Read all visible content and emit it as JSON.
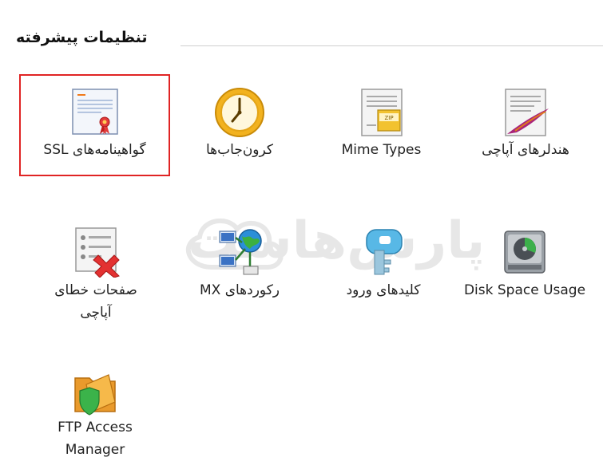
{
  "section": {
    "title": "تنظیمات پیشرفته"
  },
  "watermark": {
    "text": "پارس‌هاست"
  },
  "items": [
    {
      "label": "گواهینامه‌های SSL",
      "icon": "certificate-icon",
      "selected": true
    },
    {
      "label": "کرون‌جاب‌ها",
      "icon": "clock-icon"
    },
    {
      "label": "Mime Types",
      "icon": "zip-file-icon"
    },
    {
      "label": "هندلرهای آپاچی",
      "icon": "apache-feather-icon"
    },
    {
      "label_line1": "صفحات خطای",
      "label_line2": "آپاچی",
      "icon": "error-page-icon"
    },
    {
      "label": "رکوردهای MX",
      "icon": "network-globe-icon"
    },
    {
      "label": "کلیدهای ورود",
      "icon": "key-icon"
    },
    {
      "label": "Disk Space Usage",
      "icon": "disk-usage-icon"
    },
    {
      "label_line1": "FTP Access",
      "label_line2": "Manager",
      "icon": "folder-shield-icon"
    }
  ],
  "colors": {
    "selection_border": "#e02424",
    "divider": "#cfcfcf",
    "text": "#222222"
  }
}
